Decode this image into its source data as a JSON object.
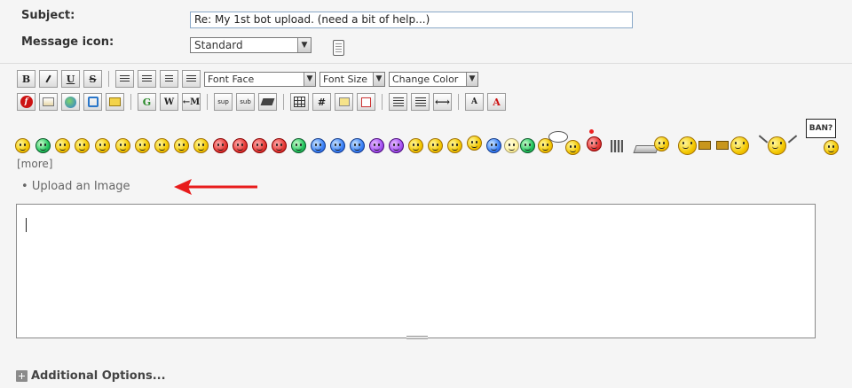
{
  "form": {
    "subject_label": "Subject:",
    "subject_value": "Re: My 1st bot upload. (need a bit of help...)",
    "message_icon_label": "Message icon:",
    "message_icon_value": "Standard"
  },
  "toolbar": {
    "row1": {
      "bold": "B",
      "underline": "U",
      "strike": "S",
      "font_face": "Font Face",
      "font_size": "Font Size",
      "change_color": "Change Color"
    },
    "row2": {
      "google": "G",
      "sup": "sup",
      "sub": "sub",
      "hash": "#"
    },
    "icons": [
      "bold-icon",
      "italic-icon",
      "underline-icon",
      "strike-icon",
      "align-left-icon",
      "align-justify-icon",
      "align-center-icon",
      "align-right-icon",
      "flash-icon",
      "image-icon",
      "web-globe-icon",
      "move-icon",
      "ftp-icon",
      "google-icon",
      "wikipedia-icon",
      "email-icon",
      "superscript-icon",
      "subscript-icon",
      "teletype-icon",
      "table-icon",
      "hash-icon",
      "quote-icon",
      "spoiler-icon",
      "list-icon",
      "ordered-list-icon",
      "horizontal-rule-icon",
      "font-size-icon",
      "text-color-icon"
    ]
  },
  "smilies": {
    "more_label": "[more]",
    "ban_sign": "BAN?"
  },
  "upload_link": "Upload an Image",
  "additional_options": "Additional Options...",
  "colors": {
    "arrow": "#e81c1c",
    "input_border": "#8aa8c8",
    "background": "#f5f5f5"
  }
}
